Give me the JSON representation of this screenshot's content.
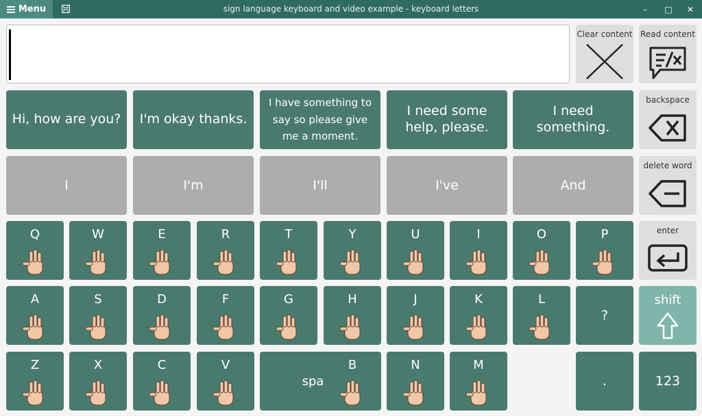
{
  "window": {
    "title": "sign language keyboard and video example - keyboard letters",
    "menu_label": "Menu",
    "menu_icon": "hamburger-icon",
    "save_icon": "save-icon",
    "minimize_symbol": "–",
    "maximize_symbol": "□",
    "close_symbol": "✕"
  },
  "textbox": {
    "value": ""
  },
  "controls": {
    "clear_label": "Clear content",
    "read_label": "Read content",
    "backspace_label": "backspace",
    "delete_word_label": "delete word",
    "enter_label": "enter"
  },
  "phrases": [
    "Hi, how are you?",
    "I'm okay thanks.",
    "I have something to say so please give me a moment.",
    "I need some help, please.",
    "I need something."
  ],
  "words": [
    "I",
    "I'm",
    "I'll",
    "I've",
    "And"
  ],
  "letters": {
    "row1": [
      "Q",
      "W",
      "E",
      "R",
      "T",
      "Y",
      "U",
      "I",
      "O",
      "P"
    ],
    "row2": [
      "A",
      "S",
      "D",
      "F",
      "G",
      "H",
      "J",
      "K",
      "L"
    ],
    "row3a": [
      "Z",
      "X",
      "C",
      "V"
    ],
    "row3b": [
      "B",
      "N",
      "M"
    ]
  },
  "keys": {
    "question": "?",
    "period": ".",
    "shift": "shift",
    "space": "space",
    "numbers": "123"
  },
  "colors": {
    "key_green": "#4a7a6e",
    "title_bar": "#2f6b63",
    "shift_key": "#7fb5aa",
    "word_key": "#adadad",
    "control_key": "#dedede",
    "hand_skin": "#f0c8a8"
  }
}
